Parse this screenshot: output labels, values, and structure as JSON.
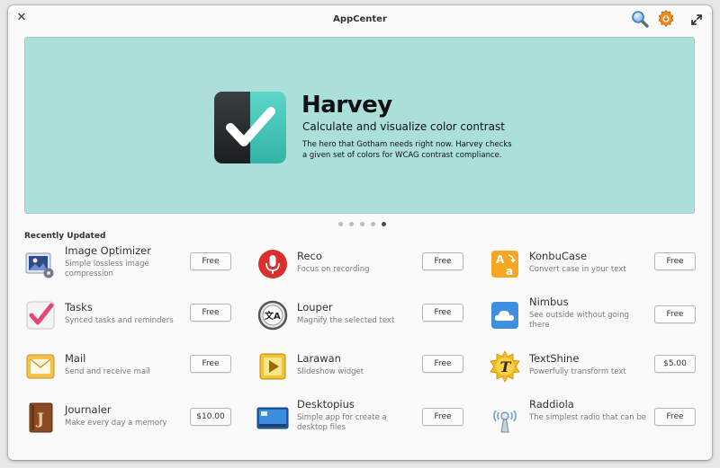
{
  "window": {
    "title": "AppCenter",
    "close_glyph": "✕",
    "header_icons": [
      "search-icon",
      "updates-gear-icon",
      "maximize-icon"
    ]
  },
  "banner": {
    "name": "Harvey",
    "summary": "Calculate and visualize color contrast",
    "description": "The hero that Gotham needs right now. Harvey checks a given set of colors for WCAG contrast compliance.",
    "background": "#abdfda",
    "pages": 5,
    "active_page": 5
  },
  "recently_updated": {
    "title": "Recently Updated",
    "apps": [
      {
        "name": "Image Optimizer",
        "summary": "Simple lossless image compression",
        "price": "Free",
        "icon": "image-optimizer-icon"
      },
      {
        "name": "Reco",
        "summary": "Focus on recording",
        "price": "Free",
        "icon": "microphone-icon"
      },
      {
        "name": "KonbuCase",
        "summary": "Convert case in your text",
        "price": "Free",
        "icon": "text-case-icon"
      },
      {
        "name": "Tasks",
        "summary": "Synced tasks and reminders",
        "price": "Free",
        "icon": "checkmark-icon"
      },
      {
        "name": "Louper",
        "summary": "Magnify the selected text",
        "price": "Free",
        "icon": "magnifier-icon"
      },
      {
        "name": "Nimbus",
        "summary": "See outside without going there",
        "price": "Free",
        "icon": "cloud-icon"
      },
      {
        "name": "Mail",
        "summary": "Send and receive mail",
        "price": "Free",
        "icon": "envelope-icon"
      },
      {
        "name": "Larawan",
        "summary": "Slideshow widget",
        "price": "Free",
        "icon": "play-icon"
      },
      {
        "name": "TextShine",
        "summary": "Powerfully transform text",
        "price": "$5.00",
        "icon": "sun-t-icon"
      },
      {
        "name": "Journaler",
        "summary": "Make every day a memory",
        "price": "$10.00",
        "icon": "journal-icon"
      },
      {
        "name": "Desktopius",
        "summary": "Simple app for create a desktop files",
        "price": "Free",
        "icon": "desktop-icon"
      },
      {
        "name": "Raddiola",
        "summary": "The simplest radio that can be",
        "price": "Free",
        "icon": "radio-antenna-icon"
      }
    ]
  },
  "colors": {
    "accent_banner": "#abdfda",
    "text": "#333333",
    "summary_text": "#7a7a7a"
  }
}
